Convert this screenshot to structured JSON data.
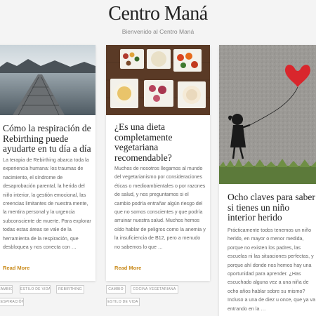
{
  "site": {
    "title": "Centro Maná",
    "tagline": "Bienvenido al Centro Maná"
  },
  "posts": [
    {
      "image": "pier-over-lake",
      "title": "Cómo la respiración de Rebirthing puede ayudarte en tu día a día",
      "excerpt": "La terapia de Rebirthing abarca toda la experiencia humana: los traumas de nacimiento, el síndrome de desaprobación parental, la herida del niño interior, la gestión emocional, las creencias limitantes de nuestra mente, la mentira personal y la urgencia subconsciente de muerte. Para explorar todas estas áreas se vale de la herramienta de la respiración, que desbloquea y nos conecta con …",
      "read_more": "Read More",
      "tags": [
        "CAMBIO",
        "ESTILO DE VIDA",
        "REBIRTHING",
        "RESPIRACIÓN"
      ]
    },
    {
      "image": "vegetarian-food-bowls",
      "title": "¿Es una dieta completamente vegetariana recomendable?",
      "excerpt": "Muchos de nosotros llegamos al mundo del vegetarianismo por consideraciones éticas o medioambientales o por razones de salud, y nos preguntamos si el cambio podría entrañar algún riesgo del que no somos conscientes y que podría arruinar nuestra salud. Muchos hemos oído hablar de peligros como la anemia y la insuficiencia de B12, pero a menudo no sabemos lo que …",
      "read_more": "Read More",
      "tags": [
        "CAMBIO",
        "COCINA VEGETARIANA",
        "ESTILO DE VIDA"
      ]
    },
    {
      "image": "girl-with-heart-balloon",
      "title": "Ocho claves para saber si tienes un niño interior herido",
      "excerpt": "Prácticamente todos tenemos un niño herido, en mayor o menor medida, porque no existen los padres, las escuelas ni las situaciones perfectas, y porque ahí donde nos hemos hay una oportunidad para aprender. ¿Has escuchado alguna vez a una niña de ocho años hablar sobre su mismo? Incluso a una de diez u once, que ya va entrando en la …"
    }
  ],
  "colors": {
    "accent": "#c98a1a",
    "background": "#f4f4f4"
  }
}
